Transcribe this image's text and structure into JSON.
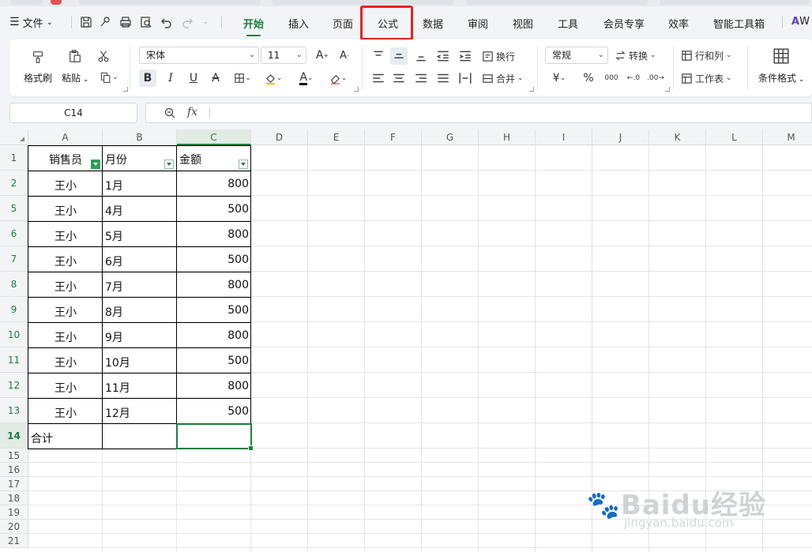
{
  "menubar": {
    "file_label": "文件",
    "tabs": [
      {
        "label": "开始",
        "active": true
      },
      {
        "label": "插入"
      },
      {
        "label": "页面"
      },
      {
        "label": "公式",
        "highlighted": true
      },
      {
        "label": "数据"
      },
      {
        "label": "审阅"
      },
      {
        "label": "视图"
      },
      {
        "label": "工具"
      },
      {
        "label": "会员专享"
      },
      {
        "label": "效率"
      },
      {
        "label": "智能工具箱"
      }
    ],
    "overflow_label": "W"
  },
  "ribbon": {
    "format_painter": "格式刷",
    "paste": "粘贴",
    "font_name": "宋体",
    "font_size": "11",
    "wrap_text": "换行",
    "merge": "合并",
    "number_format": "常规",
    "convert": "转换",
    "rows_cols": "行和列",
    "worksheet": "工作表",
    "conditional_format": "条件格式",
    "currency_symbol": "¥",
    "percent_symbol": "%",
    "thousands_symbol": "000",
    "font_color": "#c00000"
  },
  "namebox": {
    "value": "C14"
  },
  "formula_bar": {
    "fx": "fx",
    "value": ""
  },
  "sheet": {
    "columns": [
      "A",
      "B",
      "C",
      "D",
      "E",
      "F",
      "G",
      "H",
      "I",
      "J",
      "K",
      "L",
      "M"
    ],
    "selected_column": "C",
    "row_numbers": [
      "1",
      "2",
      "5",
      "6",
      "7",
      "8",
      "9",
      "10",
      "11",
      "12",
      "13",
      "14",
      "15",
      "16",
      "17",
      "18",
      "19",
      "20",
      "21"
    ],
    "selected_row": "14",
    "headers": {
      "a1": "销售员",
      "b1": "月份",
      "c1": "金额"
    },
    "rows": [
      {
        "a": "王小",
        "b": "1月",
        "c": "800"
      },
      {
        "a": "王小",
        "b": "4月",
        "c": "500"
      },
      {
        "a": "王小",
        "b": "5月",
        "c": "800"
      },
      {
        "a": "王小",
        "b": "6月",
        "c": "500"
      },
      {
        "a": "王小",
        "b": "7月",
        "c": "800"
      },
      {
        "a": "王小",
        "b": "8月",
        "c": "500"
      },
      {
        "a": "王小",
        "b": "9月",
        "c": "800"
      },
      {
        "a": "王小",
        "b": "10月",
        "c": "500"
      },
      {
        "a": "王小",
        "b": "11月",
        "c": "800"
      },
      {
        "a": "王小",
        "b": "12月",
        "c": "500"
      }
    ],
    "total_label": "合计",
    "selected_cell": "C14"
  },
  "watermark": {
    "text": "Baidu经验",
    "sub": "jingyan.baidu.com"
  },
  "colors": {
    "accent": "#1b7f3d",
    "highlight_box": "#e8231f"
  }
}
